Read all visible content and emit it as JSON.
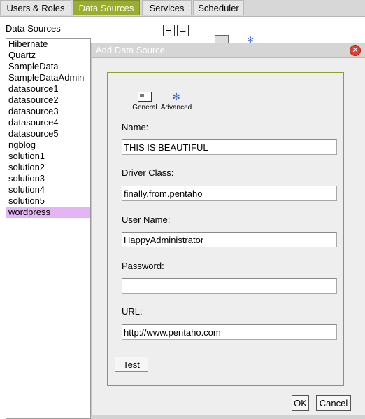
{
  "tabs": [
    "Users & Roles",
    "Data Sources",
    "Services",
    "Scheduler"
  ],
  "active_tab": "Data Sources",
  "datasources": {
    "title": "Data Sources",
    "add_label": "+",
    "remove_label": "–",
    "items": [
      "Hibernate",
      "Quartz",
      "SampleData",
      "SampleDataAdmin",
      "datasource1",
      "datasource2",
      "datasource3",
      "datasource4",
      "datasource5",
      "ngblog",
      "solution1",
      "solution2",
      "solution3",
      "solution4",
      "solution5",
      "wordpress"
    ],
    "selected": "wordpress"
  },
  "dialog": {
    "title": "Add Data Source",
    "tabs": {
      "general": "General",
      "advanced": "Advanced"
    },
    "fields": {
      "name": {
        "label": "Name:",
        "value": "THIS IS BEAUTIFUL"
      },
      "driver": {
        "label": "Driver Class:",
        "value": "finally.from.pentaho"
      },
      "user": {
        "label": "User Name:",
        "value": "HappyAdministrator"
      },
      "password": {
        "label": "Password:",
        "value": ""
      },
      "url": {
        "label": "URL:",
        "value": "http://www.pentaho.com"
      }
    },
    "test_label": "Test",
    "ok_label": "OK",
    "cancel_label": "Cancel"
  }
}
